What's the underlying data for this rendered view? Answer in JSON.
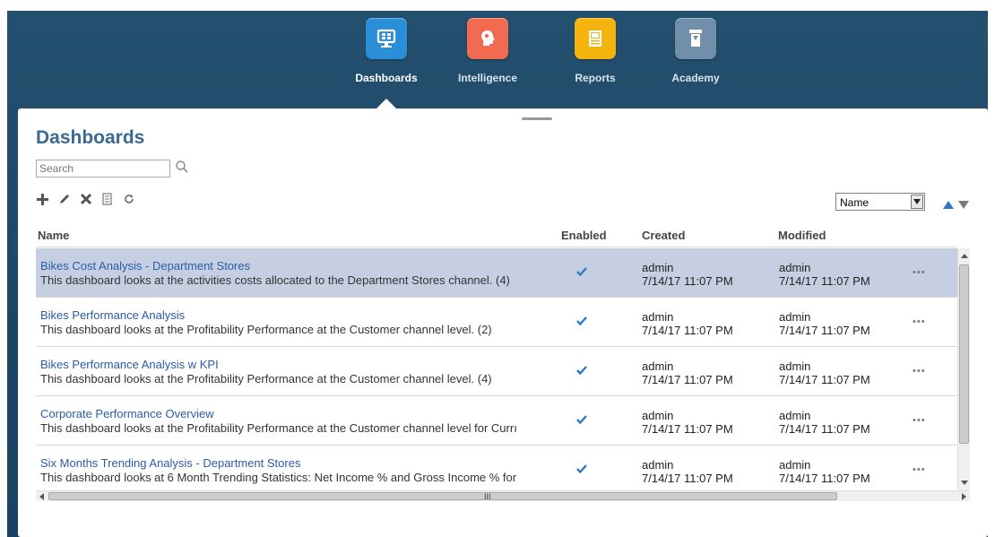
{
  "nav": {
    "items": [
      {
        "label": "Dashboards",
        "icon": "monitor-icon",
        "color": "#2b8fd8"
      },
      {
        "label": "Intelligence",
        "icon": "brain-head-icon",
        "color": "#f26b50"
      },
      {
        "label": "Reports",
        "icon": "report-icon",
        "color": "#f5b40d"
      },
      {
        "label": "Academy",
        "icon": "academy-icon",
        "color": "#6f8fab"
      }
    ],
    "active": "Dashboards"
  },
  "page": {
    "title": "Dashboards",
    "search_placeholder": "Search"
  },
  "toolbar": {
    "actions": [
      "add-icon",
      "edit-icon",
      "delete-icon",
      "copy-icon",
      "refresh-icon"
    ]
  },
  "sort": {
    "selected": "Name"
  },
  "table": {
    "headers": {
      "name": "Name",
      "enabled": "Enabled",
      "created": "Created",
      "modified": "Modified"
    },
    "rows": [
      {
        "name": "Bikes Cost Analysis - Department Stores",
        "description": "This dashboard looks at the activities costs allocated to the Department Stores channel. (4)",
        "enabled": true,
        "created_by": "admin",
        "created": "7/14/17 11:07 PM",
        "modified_by": "admin",
        "modified": "7/14/17 11:07 PM",
        "more": "•••",
        "selected": true
      },
      {
        "name": "Bikes Performance Analysis",
        "description": "This dashboard looks at the Profitability Performance at the Customer channel level. (2)",
        "enabled": true,
        "created_by": "admin",
        "created": "7/14/17 11:07 PM",
        "modified_by": "admin",
        "modified": "7/14/17 11:07 PM",
        "more": "•••",
        "selected": false
      },
      {
        "name": "Bikes Performance Analysis w KPI",
        "description": "This dashboard looks at the Profitability Performance at the Customer channel level. (4)",
        "enabled": true,
        "created_by": "admin",
        "created": "7/14/17 11:07 PM",
        "modified_by": "admin",
        "modified": "7/14/17 11:07 PM",
        "more": "•••",
        "selected": false
      },
      {
        "name": "Corporate Performance Overview",
        "description": "This dashboard looks at the Profitability Performance at the Customer channel level for Currı",
        "enabled": true,
        "created_by": "admin",
        "created": "7/14/17 11:07 PM",
        "modified_by": "admin",
        "modified": "7/14/17 11:07 PM",
        "more": "•••",
        "selected": false
      },
      {
        "name": "Six Months Trending Analysis - Department Stores",
        "description": "This dashboard looks at 6 Month Trending Statistics: Net Income % and Gross Income % for",
        "enabled": true,
        "created_by": "admin",
        "created": "7/14/17 11:07 PM",
        "modified_by": "admin",
        "modified": "7/14/17 11:07 PM",
        "more": "•••",
        "selected": false
      }
    ]
  },
  "colors": {
    "header_bg": "#1f4a6a",
    "title": "#3a6a93",
    "link": "#2a5ca8",
    "selected_row": "#c6cfe2",
    "check": "#2c79c0"
  }
}
